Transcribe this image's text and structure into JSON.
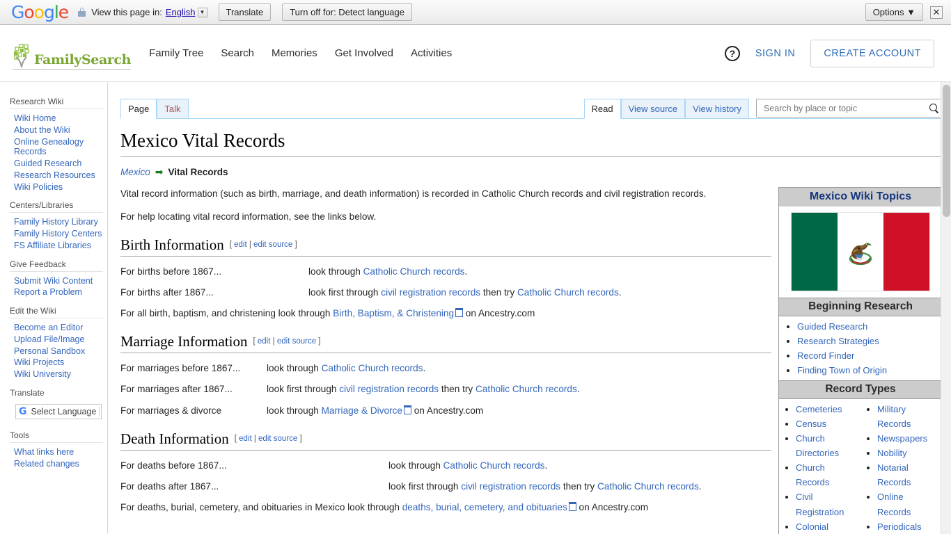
{
  "translate_bar": {
    "logo": {
      "letters": [
        "G",
        "o",
        "o",
        "g",
        "l",
        "e"
      ],
      "name": "google-logo"
    },
    "lock_icon": "lock-icon",
    "view_text": "View this page in:",
    "language": "English",
    "translate_button": "Translate",
    "turn_off_button": "Turn off for: Detect language",
    "options_button": "Options",
    "options_caret": "▼",
    "close_icon": "✕"
  },
  "fs_header": {
    "logo_text": "FamilySearch",
    "nav": [
      {
        "label": "Family Tree"
      },
      {
        "label": "Search"
      },
      {
        "label": "Memories"
      },
      {
        "label": "Get Involved"
      },
      {
        "label": "Activities"
      }
    ],
    "help_icon": "?",
    "sign_in": "SIGN IN",
    "create_account": "CREATE ACCOUNT"
  },
  "sidebar": {
    "portals": [
      {
        "heading": "Research Wiki",
        "items": [
          "Wiki Home",
          "About the Wiki",
          "Online Genealogy Records",
          "Guided Research",
          "Research Resources",
          "Wiki Policies"
        ]
      },
      {
        "heading": "Centers/Libraries",
        "items": [
          "Family History Library",
          "Family History Centers",
          "FS Affiliate Libraries"
        ]
      },
      {
        "heading": "Give Feedback",
        "items": [
          "Submit Wiki Content",
          "Report a Problem"
        ]
      },
      {
        "heading": "Edit the Wiki",
        "items": [
          "Become an Editor",
          "Upload File/Image",
          "Personal Sandbox",
          "Wiki Projects",
          "Wiki University"
        ]
      }
    ],
    "translate_heading": "Translate",
    "select_language": "Select Language",
    "tools_heading": "Tools",
    "tools_items": [
      "What links here",
      "Related changes"
    ]
  },
  "tabs": {
    "left": [
      {
        "label": "Page",
        "selected": true
      },
      {
        "label": "Talk",
        "selected": false
      }
    ],
    "right": [
      {
        "label": "Read",
        "selected": true
      },
      {
        "label": "View source",
        "selected": false
      },
      {
        "label": "View history",
        "selected": false
      }
    ]
  },
  "search": {
    "placeholder": "Search by place or topic",
    "value": "",
    "icon": "search-icon"
  },
  "article": {
    "title": "Mexico Vital Records",
    "breadcrumb": {
      "parent": "Mexico",
      "arrow": "➡",
      "current": "Vital Records"
    },
    "intro_paragraphs": [
      "Vital record information (such as birth, marriage, and death information) is recorded in Catholic Church records and civil registration records.",
      "For help locating vital record information, see the links below."
    ],
    "edit_label": "edit",
    "edit_source_label": "edit source",
    "sections": [
      {
        "heading": "Birth Information",
        "label_width": 270,
        "rows": [
          {
            "label": "For births before 1867...",
            "parts": [
              {
                "t": "look through ",
                "k": "text"
              },
              {
                "t": "Catholic Church records",
                "k": "link"
              },
              {
                "t": ".",
                "k": "text"
              }
            ]
          },
          {
            "label": "For births after 1867...",
            "parts": [
              {
                "t": "look first through ",
                "k": "text"
              },
              {
                "t": "civil registration records",
                "k": "link"
              },
              {
                "t": " then try ",
                "k": "text"
              },
              {
                "t": "Catholic Church records",
                "k": "link"
              },
              {
                "t": ".",
                "k": "text"
              }
            ]
          }
        ],
        "footer": {
          "pre": "For all birth, baptism, and christening look through ",
          "link": "Birth, Baptism, & Christening",
          "post": " on Ancestry.com"
        }
      },
      {
        "heading": "Marriage Information",
        "label_width": 210,
        "rows": [
          {
            "label": "For marriages before 1867...",
            "parts": [
              {
                "t": "look through ",
                "k": "text"
              },
              {
                "t": "Catholic Church records",
                "k": "link"
              },
              {
                "t": ".",
                "k": "text"
              }
            ]
          },
          {
            "label": "For marriages after 1867...",
            "parts": [
              {
                "t": "look first through ",
                "k": "text"
              },
              {
                "t": "civil registration records",
                "k": "link"
              },
              {
                "t": " then try ",
                "k": "text"
              },
              {
                "t": "Catholic Church records",
                "k": "link"
              },
              {
                "t": ".",
                "k": "text"
              }
            ]
          },
          {
            "label": "For marriages & divorce",
            "parts": [
              {
                "t": "look through ",
                "k": "text"
              },
              {
                "t": "Marriage & Divorce",
                "k": "extlink"
              },
              {
                "t": " on Ancestry.com",
                "k": "text"
              }
            ]
          }
        ],
        "footer": null
      },
      {
        "heading": "Death Information",
        "label_width": 385,
        "rows": [
          {
            "label": "For deaths before 1867...",
            "parts": [
              {
                "t": "look through ",
                "k": "text"
              },
              {
                "t": "Catholic Church records",
                "k": "link"
              },
              {
                "t": ".",
                "k": "text"
              }
            ]
          },
          {
            "label": "For deaths after 1867...",
            "parts": [
              {
                "t": "look first through ",
                "k": "text"
              },
              {
                "t": "civil registration records",
                "k": "link"
              },
              {
                "t": " then try ",
                "k": "text"
              },
              {
                "t": "Catholic Church records",
                "k": "link"
              },
              {
                "t": ".",
                "k": "text"
              }
            ]
          }
        ],
        "footer": {
          "pre": "For deaths, burial, cemetery, and obituaries in Mexico look through ",
          "link": "deaths, burial, cemetery, and obituaries",
          "post": " on Ancestry.com"
        }
      }
    ]
  },
  "infobox": {
    "title": "Mexico Wiki Topics",
    "flag": {
      "name": "mexico-flag",
      "green": "#006847",
      "white": "#ffffff",
      "red": "#ce1126"
    },
    "sections": [
      {
        "heading": "Beginning Research",
        "columns": [
          [
            "Guided Research",
            "Research Strategies",
            "Record Finder",
            "Finding Town of Origin"
          ]
        ]
      },
      {
        "heading": "Record Types",
        "columns": [
          [
            "Cemeteries",
            "Census",
            "Church Directories",
            "Church Records",
            "Civil Registration",
            "Colonial"
          ],
          [
            "Military Records",
            "Newspapers",
            "Nobility",
            "Notarial Records",
            "Online Records",
            "Periodicals"
          ]
        ]
      }
    ]
  },
  "colors": {
    "fs_green": "#7aa632",
    "link_blue": "#3366bb",
    "accent_blue": "#2f6fb5",
    "tab_border": "#a7d7f9",
    "infobox_header_bg": "#cccccc",
    "infobox_title_color": "#16387d"
  }
}
